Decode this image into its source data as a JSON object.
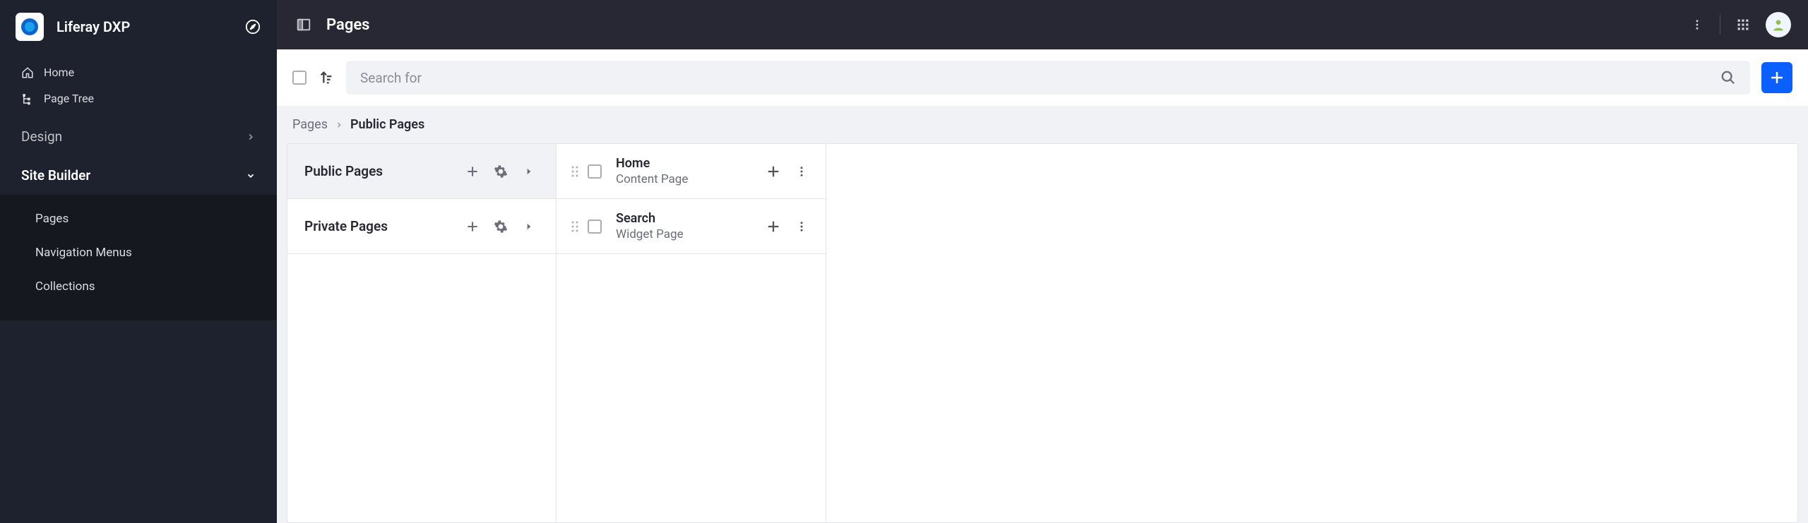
{
  "brand": {
    "title": "Liferay DXP"
  },
  "sidebar": {
    "nav": [
      {
        "label": "Home"
      },
      {
        "label": "Page Tree"
      }
    ],
    "sections": [
      {
        "label": "Design",
        "expanded": false
      },
      {
        "label": "Site Builder",
        "expanded": true,
        "children": [
          {
            "label": "Pages"
          },
          {
            "label": "Navigation Menus"
          },
          {
            "label": "Collections"
          }
        ]
      }
    ]
  },
  "header": {
    "title": "Pages"
  },
  "toolbar": {
    "search_placeholder": "Search for"
  },
  "breadcrumb": {
    "items": [
      "Pages",
      "Public Pages"
    ]
  },
  "page_sets": [
    {
      "label": "Public Pages",
      "active": true
    },
    {
      "label": "Private Pages",
      "active": false
    }
  ],
  "pages": [
    {
      "title": "Home",
      "type": "Content Page"
    },
    {
      "title": "Search",
      "type": "Widget Page"
    }
  ],
  "colors": {
    "primary": "#0b5fff",
    "dark_bg": "#272833",
    "sidebar_bg": "#1e222e"
  }
}
